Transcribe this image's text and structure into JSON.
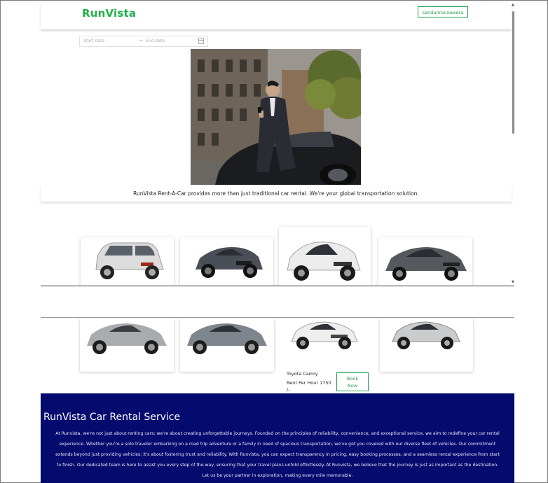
{
  "header": {
    "brand": "RunVista",
    "user_button": "sandunranaweera"
  },
  "date_range": {
    "start_placeholder": "Start date",
    "arrow": "→",
    "end_placeholder": "End date"
  },
  "hero": {
    "tagline": "RunVista Rent-A-Car provides more than just traditional car rental. We're your global transportation solution."
  },
  "cars_row1": [
    {
      "icon": "white-hatchback-car-image",
      "color": "#d9d9d9"
    },
    {
      "icon": "grey-sedan-car-image",
      "color": "#4a4f57"
    },
    {
      "icon": "white-hatchback-car-image",
      "color": "#e6e6e6"
    },
    {
      "icon": "dark-sedan-car-image",
      "color": "#55585d"
    }
  ],
  "cars_row2": [
    {
      "icon": "silver-sedan-car-image",
      "color": "#a9abad"
    },
    {
      "icon": "grey-sedan-car-image",
      "color": "#7e858d"
    },
    {
      "icon": "white-sedan-car-image",
      "color": "#eeeeee",
      "name": "Toyota Camry",
      "price": "Rent Per Hour 1750",
      "price_suffix": "/-",
      "book_label_1": "Book",
      "book_label_2": "Now"
    },
    {
      "icon": "silver-sedan-car-image",
      "color": "#c9cbcd"
    }
  ],
  "footer": {
    "title": "RunVista Car Rental Service",
    "lines": [
      "At Runvista, we're not just about renting cars; we're about creating unforgettable journeys. Founded on the principles of reliability, convenience, and exceptional service, we aim to redefine your car rental",
      "experience. Whether you're a solo traveler embarking on a road trip adventure or a family in need of spacious transportation, we've got you covered with our diverse fleet of vehicles. Our commitment",
      "extends beyond just providing vehicles; it's about fostering trust and reliability. With Runvista, you can expect transparency in pricing, easy booking processes, and a seamless rental experience from start",
      "to finish. Our dedicated team is here to assist you every step of the way, ensuring that your travel plans unfold effortlessly. At Runvista, we believe that the journey is just as important as the destination.",
      "Let us be your partner in exploration, making every mile memorable."
    ]
  }
}
